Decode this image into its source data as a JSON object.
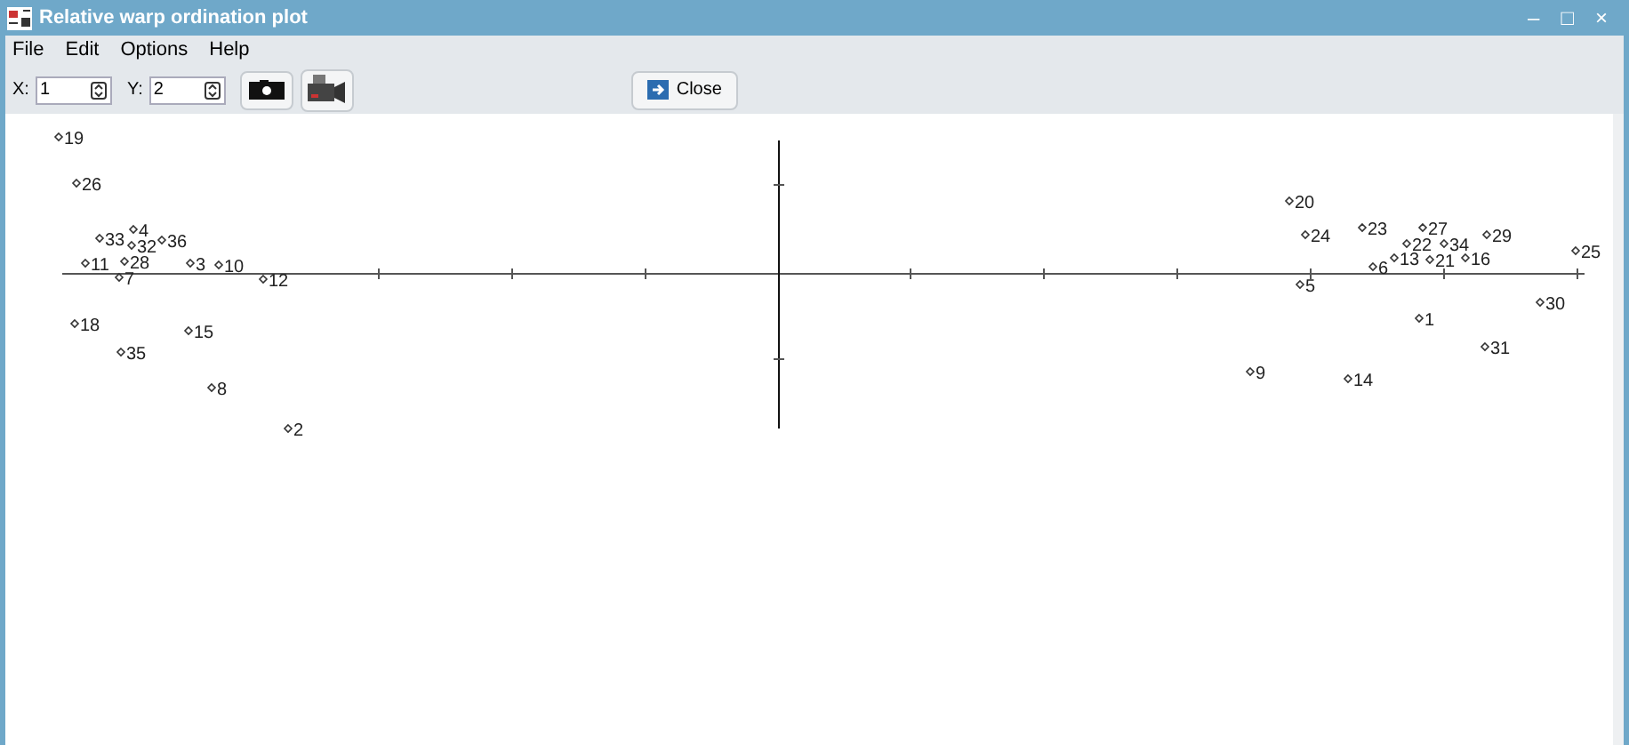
{
  "window": {
    "title": "Relative warp ordination plot",
    "controls": [
      "–",
      "□",
      "×"
    ]
  },
  "menu": [
    "File",
    "Edit",
    "Options",
    "Help"
  ],
  "toolbar": {
    "x_label": "X:",
    "x_value": "1",
    "y_label": "Y:",
    "y_value": "2",
    "close_button": "Close"
  },
  "plot": {
    "points": [
      "19",
      "26",
      "20",
      "4",
      "23",
      "27",
      "33",
      "32",
      "36",
      "24",
      "22",
      "34",
      "29",
      "21",
      "16",
      "25",
      "11",
      "7",
      "28",
      "3",
      "10",
      "12",
      "5",
      "6",
      "13",
      "30",
      "18",
      "15",
      "1",
      "35",
      "31",
      "8",
      "9",
      "14",
      "2"
    ]
  }
}
